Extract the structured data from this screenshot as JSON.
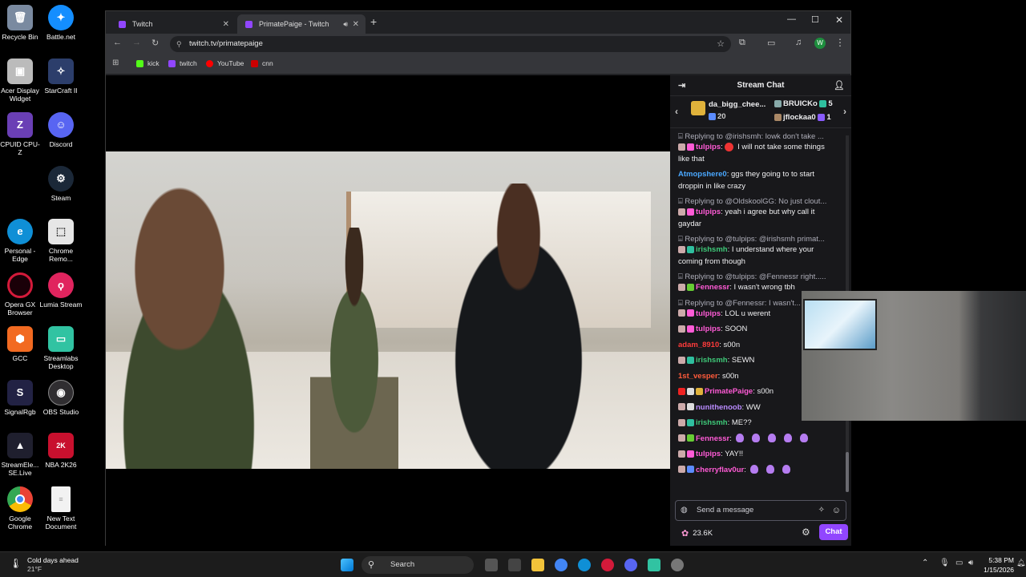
{
  "desktop_icons": [
    {
      "label": "Recycle Bin",
      "color": "#7a8aa0"
    },
    {
      "label": "Battle.net",
      "color": "#148eff"
    },
    {
      "label": "Acer Display Widget",
      "color": "#bbbbbb"
    },
    {
      "label": "StarCraft II",
      "color": "#2c3e6b"
    },
    {
      "label": "CPUID CPU-Z",
      "color": "#6a3fb5"
    },
    {
      "label": "Discord",
      "color": "#5865f2"
    },
    {
      "label": "Steam",
      "color": "#1b2838"
    },
    {
      "label": "Personal - Edge",
      "color": "#0f8fd6"
    },
    {
      "label": "Chrome Remo...",
      "color": "#e6e6e6"
    },
    {
      "label": "Opera GX Browser",
      "color": "#d31a3a"
    },
    {
      "label": "Lumia Stream",
      "color": "#e0245e"
    },
    {
      "label": "GCC",
      "color": "#f26a21"
    },
    {
      "label": "Streamlabs Desktop",
      "color": "#31c3a2"
    },
    {
      "label": "SignalRgb",
      "color": "#222244"
    },
    {
      "label": "OBS Studio",
      "color": "#302e31"
    },
    {
      "label": "StreamEle... SE.Live",
      "color": "#1f1f2e"
    },
    {
      "label": "NBA 2K26",
      "color": "#c8102e"
    },
    {
      "label": "Google Chrome",
      "color": "#4285f4"
    },
    {
      "label": "New Text Document",
      "color": "#f2f2f2"
    }
  ],
  "browser": {
    "tabs": [
      {
        "title": "Twitch"
      },
      {
        "title": "PrimatePaige - Twitch"
      }
    ],
    "url": "twitch.tv/primatepaige",
    "profile_initial": "W",
    "bookmarks": [
      {
        "label": "kick",
        "color": "#53fc18"
      },
      {
        "label": "twitch",
        "color": "#9146ff"
      },
      {
        "label": "YouTube",
        "color": "#ff0000"
      },
      {
        "label": "cnn",
        "color": "#cc0000"
      }
    ]
  },
  "chat": {
    "title": "Stream Chat",
    "gifters": {
      "top": {
        "name": "da_bigg_chee...",
        "count": "20"
      },
      "others": [
        {
          "name": "BRUICKo",
          "count": "5"
        },
        {
          "name": "jflockaa0",
          "count": "1"
        }
      ]
    },
    "messages": [
      {
        "reply": "Replying to @irishsmh: lowk don't take ...",
        "user": "tulpips",
        "user_color": "#ff5bd6",
        "text": "I will not take some things like that"
      },
      {
        "user": "Atmopshere0",
        "user_color": "#4aa8ff",
        "text": "ggs they going to to start droppin in like crazy"
      },
      {
        "reply": "Replying to @OldskoolGG: No just clout...",
        "user": "tulpips",
        "user_color": "#ff5bd6",
        "text": "yeah i agree but why call it gaydar"
      },
      {
        "reply": "Replying to @tulpips: @irishsmh primat...",
        "user": "irishsmh",
        "user_color": "#3ec878",
        "text": "I understand where your coming from though"
      },
      {
        "reply": "Replying to @tulpips: @Fennessr right.....",
        "user": "Fennessr",
        "user_color": "#ff5bd6",
        "text": "I wasn't wrong tbh"
      },
      {
        "reply": "Replying to @Fennessr: I wasn't...",
        "user": "tulpips",
        "user_color": "#ff5bd6",
        "text": "LOL u werent"
      },
      {
        "user": "tulpips",
        "user_color": "#ff5bd6",
        "text": "SOON"
      },
      {
        "user": "adam_8910",
        "user_color": "#ff3b3b",
        "text": "s00n"
      },
      {
        "user": "irishsmh",
        "user_color": "#3ec878",
        "text": "SEWN"
      },
      {
        "user": "1st_vesper",
        "user_color": "#ff5b3b",
        "text": "s00n"
      },
      {
        "user": "PrimatePaige",
        "user_color": "#ff5bd6",
        "text": "s00n"
      },
      {
        "user": "nunithenoob",
        "user_color": "#b98bff",
        "text": "WW"
      },
      {
        "user": "irishsmh",
        "user_color": "#3ec878",
        "text": "ME??"
      },
      {
        "user": "Fennessr",
        "user_color": "#ff5bd6",
        "text": "",
        "emotes": 5
      },
      {
        "user": "tulpips",
        "user_color": "#ff5bd6",
        "text": "YAY!!"
      },
      {
        "user": "cherryflav0ur",
        "user_color": "#ff5bd6",
        "text": "",
        "emotes": 3
      }
    ],
    "input_placeholder": "Send a message",
    "points": "23.6K",
    "chat_button": "Chat"
  },
  "taskbar": {
    "weather": {
      "text": "Cold days ahead",
      "temp": "21°F"
    },
    "search_label": "Search",
    "time": "5:38 PM",
    "date": "1/15/2026"
  }
}
